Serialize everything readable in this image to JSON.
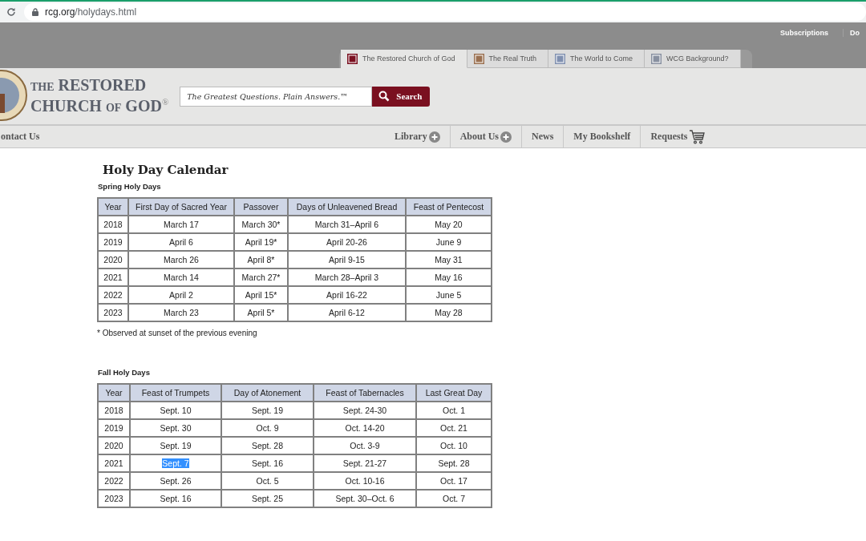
{
  "browser": {
    "url_host": "rcg.org",
    "url_path": "/holydays.html"
  },
  "utility_links": [
    "Subscriptions",
    "Do"
  ],
  "site_tabs": [
    {
      "label": "The Restored Church of God",
      "selected": true
    },
    {
      "label": "The Real Truth",
      "selected": false
    },
    {
      "label": "The World to Come",
      "selected": false
    },
    {
      "label": "WCG Background?",
      "selected": false
    }
  ],
  "logo": {
    "line_1_small": "THE",
    "line_1": "RESTORED",
    "line_2": "CHURCH",
    "line_2_small": "OF",
    "line_2_end": "GOD",
    "mark": "®"
  },
  "search": {
    "placeholder": "The Greatest Questions. Plain Answers.™",
    "button": "Search"
  },
  "nav_left": "ontact Us",
  "nav": [
    {
      "label": "Library",
      "kind": "expand"
    },
    {
      "label": "About Us",
      "kind": "expand"
    },
    {
      "label": "News",
      "kind": "plain"
    },
    {
      "label": "My Bookshelf",
      "kind": "plain"
    },
    {
      "label": "Requests",
      "kind": "cart"
    }
  ],
  "page_title": "Holy Day Calendar",
  "spring": {
    "title": "Spring Holy Days",
    "columns": [
      "Year",
      "First Day of Sacred Year",
      "Passover",
      "Days of Unleavened Bread",
      "Feast of Pentecost"
    ],
    "rows": [
      [
        "2018",
        "March 17",
        "March 30*",
        "March 31–April 6",
        "May 20"
      ],
      [
        "2019",
        "April 6",
        "April 19*",
        "April 20-26",
        "June 9"
      ],
      [
        "2020",
        "March 26",
        "April 8*",
        "April 9-15",
        "May 31"
      ],
      [
        "2021",
        "March 14",
        "March 27*",
        "March 28–April 3",
        "May 16"
      ],
      [
        "2022",
        "April 2",
        "April 15*",
        "April 16-22",
        "June 5"
      ],
      [
        "2023",
        "March 23",
        "April 5*",
        "April 6-12",
        "May 28"
      ]
    ],
    "footnote": "* Observed at sunset of the previous evening"
  },
  "fall": {
    "title": "Fall Holy Days",
    "columns": [
      "Year",
      "Feast of Trumpets",
      "Day of Atonement",
      "Feast of Tabernacles",
      "Last Great Day"
    ],
    "rows": [
      [
        {
          "text": "2018",
          "highlighted": false
        },
        {
          "text": "Sept. 10",
          "highlighted": false
        },
        {
          "text": "Sept. 19",
          "highlighted": false
        },
        {
          "text": "Sept. 24-30",
          "highlighted": false
        },
        {
          "text": "Oct. 1",
          "highlighted": false
        }
      ],
      [
        {
          "text": "2019",
          "highlighted": false
        },
        {
          "text": "Sept. 30",
          "highlighted": false
        },
        {
          "text": "Oct. 9",
          "highlighted": false
        },
        {
          "text": "Oct. 14-20",
          "highlighted": false
        },
        {
          "text": "Oct. 21",
          "highlighted": false
        }
      ],
      [
        {
          "text": "2020",
          "highlighted": false
        },
        {
          "text": "Sept. 19",
          "highlighted": false
        },
        {
          "text": "Sept. 28",
          "highlighted": false
        },
        {
          "text": "Oct. 3-9",
          "highlighted": false
        },
        {
          "text": "Oct. 10",
          "highlighted": false
        }
      ],
      [
        {
          "text": "2021",
          "highlighted": false
        },
        {
          "text": "Sept. 7",
          "highlighted": true
        },
        {
          "text": "Sept. 16",
          "highlighted": false
        },
        {
          "text": "Sept. 21-27",
          "highlighted": false
        },
        {
          "text": "Sept. 28",
          "highlighted": false
        }
      ],
      [
        {
          "text": "2022",
          "highlighted": false
        },
        {
          "text": "Sept. 26",
          "highlighted": false
        },
        {
          "text": "Oct. 5",
          "highlighted": false
        },
        {
          "text": "Oct. 10-16",
          "highlighted": false
        },
        {
          "text": "Oct. 17",
          "highlighted": false
        }
      ],
      [
        {
          "text": "2023",
          "highlighted": false
        },
        {
          "text": "Sept. 16",
          "highlighted": false
        },
        {
          "text": "Sept. 25",
          "highlighted": false
        },
        {
          "text": "Sept. 30–Oct. 6",
          "highlighted": false
        },
        {
          "text": "Oct. 7",
          "highlighted": false
        }
      ]
    ]
  }
}
